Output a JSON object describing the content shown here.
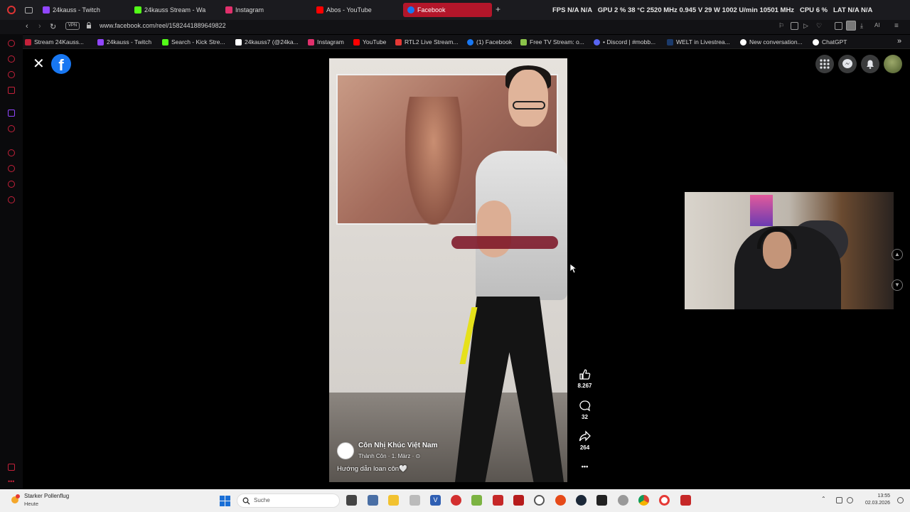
{
  "browser": {
    "tabs": [
      {
        "label": "24kauss - Twitch",
        "color": "#9146ff"
      },
      {
        "label": "24kauss Stream - Wa",
        "color": "#53fc18"
      },
      {
        "label": "Instagram",
        "color": "#e1306c"
      },
      {
        "label": "Abos - YouTube",
        "color": "#ff0000"
      },
      {
        "label": "Facebook",
        "color": "#1877f2",
        "active": true
      }
    ],
    "new_tab_symbol": "+",
    "hwinfo": {
      "fps_label": "FPS",
      "fps_value": "N/A",
      "fps_value2": "N/A",
      "gpu_label": "GPU",
      "gpu_load": "2 %",
      "gpu_temp": "38 °C",
      "gpu_clock": "2520 MHz",
      "gpu_voltage": "0.945 V",
      "gpu_power": "29 W",
      "gpu_fan": "1002 U/min",
      "gpu_mem": "10501 MHz",
      "cpu_label": "CPU",
      "cpu_load": "6 %",
      "lat_label": "LAT",
      "lat_value": "N/A",
      "lat_value2": "N/A"
    },
    "address": {
      "vpn_label": "VPN",
      "url": "www.facebook.com/reel/1582441889649822"
    },
    "bookmarks": [
      {
        "label": "Stream 24Kauss...",
        "color": "#c4213a"
      },
      {
        "label": "24kauss - Twitch",
        "color": "#9146ff"
      },
      {
        "label": "Search - Kick Stre...",
        "color": "#53fc18"
      },
      {
        "label": "24kauss7 (@24ka...",
        "color": "#ffffff"
      },
      {
        "label": "Instagram",
        "color": "#e1306c"
      },
      {
        "label": "YouTube",
        "color": "#ff0000"
      },
      {
        "label": "RTL2 Live Stream...",
        "color": "#e53935"
      },
      {
        "label": "(1) Facebook",
        "color": "#1877f2"
      },
      {
        "label": "Free TV Stream: o...",
        "color": "#8bc34a"
      },
      {
        "label": "• Discord | #mobb...",
        "color": "#5865f2"
      },
      {
        "label": "WELT in Livestrea...",
        "color": "#1b3a6b"
      },
      {
        "label": "New conversation...",
        "color": "#ffffff"
      },
      {
        "label": "ChatGPT",
        "color": "#ffffff"
      }
    ],
    "bookmarks_more": "»"
  },
  "facebook": {
    "close_symbol": "✕",
    "logo_letter": "f",
    "reel": {
      "page_name": "Côn Nhị Khúc Việt Nam",
      "meta": "Thành Côn · 1. März · ⊙",
      "caption": "Hướng dẫn loan côn🤍"
    },
    "actions": {
      "likes": "8.267",
      "comments": "32",
      "shares": "264",
      "more_symbol": "•••"
    }
  },
  "taskbar": {
    "weather_title": "Starker Pollenflug",
    "weather_sub": "Heute",
    "search_placeholder": "Suche",
    "time": "13:55",
    "date": "02.03.2026"
  }
}
